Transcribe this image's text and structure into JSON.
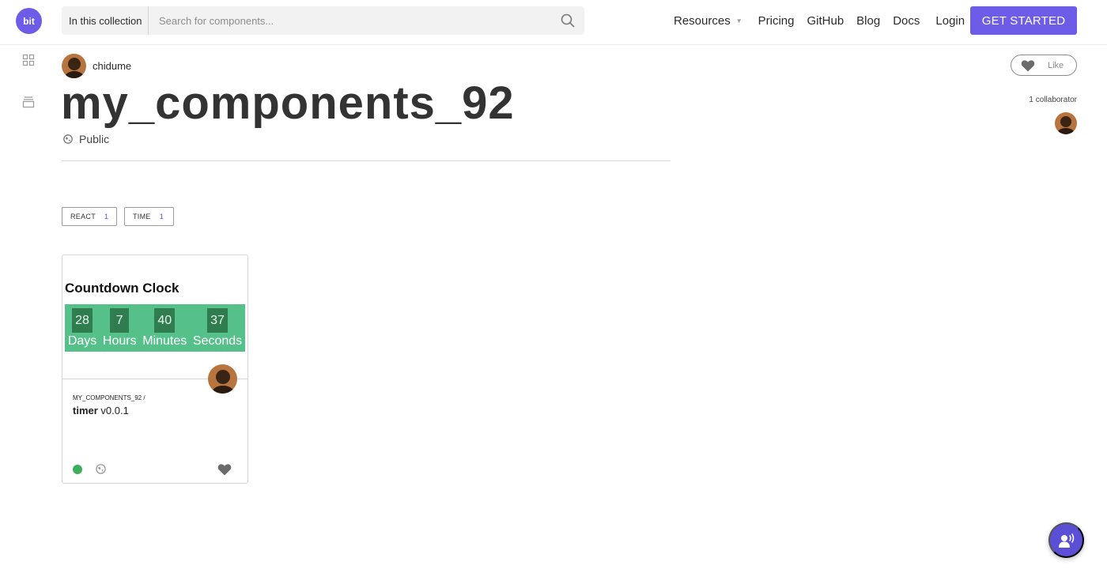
{
  "logo": {
    "text": "bit"
  },
  "rail": {
    "icons": [
      "grid-icon",
      "collection-icon"
    ]
  },
  "search": {
    "scope_label": "In this collection",
    "placeholder": "Search for components...",
    "icon": "search-icon"
  },
  "nav": {
    "items": [
      "Resources",
      "Pricing",
      "GitHub",
      "Blog",
      "Docs",
      "Login"
    ],
    "cta": "GET STARTED"
  },
  "collection": {
    "owner": "chidume",
    "title": "my_components_92",
    "visibility": "Public",
    "like_label": "Like",
    "collaborators_label": "1 collaborator"
  },
  "tags": [
    {
      "label": "REACT",
      "count": "1"
    },
    {
      "label": "TIME",
      "count": "1"
    }
  ],
  "card": {
    "preview_title": "Countdown Clock",
    "clock": [
      {
        "value": "28",
        "label": "Days"
      },
      {
        "value": "7",
        "label": "Hours"
      },
      {
        "value": "40",
        "label": "Minutes"
      },
      {
        "value": "37",
        "label": "Seconds"
      }
    ],
    "scope": "MY_COMPONENTS_92 /",
    "name": "timer",
    "version": "v0.0.1"
  },
  "colors": {
    "accent": "#6c5ce7",
    "clock_bg": "#55c08a",
    "clock_cell": "#2f7d4e",
    "status_green": "#3fae5c"
  }
}
